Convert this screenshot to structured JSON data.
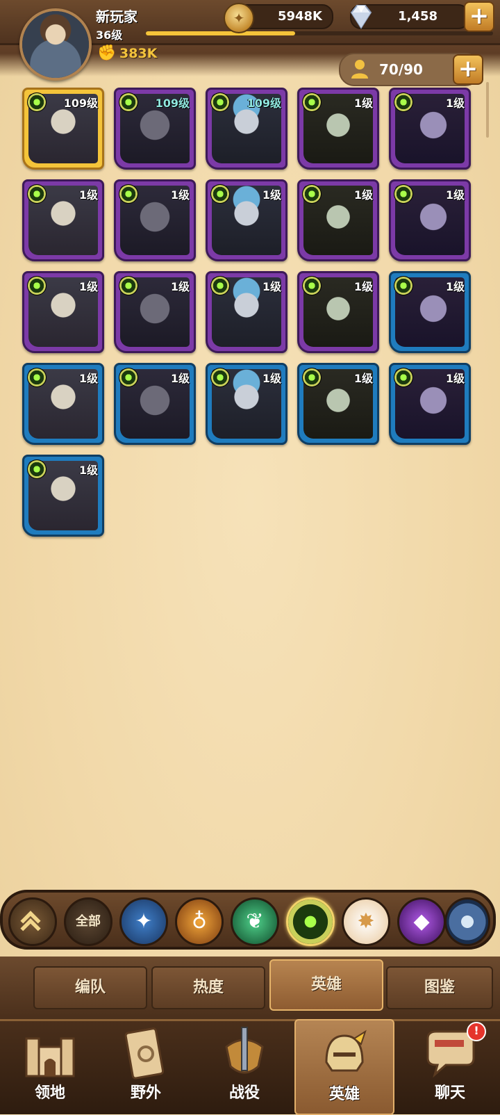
{
  "player": {
    "name": "新玩家",
    "level": "36级",
    "power": "383K",
    "xp_progress": 0.43
  },
  "resources": {
    "gold": "5948K",
    "gems": "1,458",
    "add_label": "+"
  },
  "hero_capacity": "70/90",
  "heroes": [
    {
      "level": "109级",
      "frame": "gold",
      "teal": false
    },
    {
      "level": "109级",
      "frame": "purple",
      "teal": true
    },
    {
      "level": "109级",
      "frame": "purple",
      "teal": true
    },
    {
      "level": "1级",
      "frame": "purple",
      "teal": false
    },
    {
      "level": "1级",
      "frame": "purple",
      "teal": false
    },
    {
      "level": "1级",
      "frame": "purple",
      "teal": false
    },
    {
      "level": "1级",
      "frame": "purple",
      "teal": false
    },
    {
      "level": "1级",
      "frame": "purple",
      "teal": false
    },
    {
      "level": "1级",
      "frame": "purple",
      "teal": false
    },
    {
      "level": "1级",
      "frame": "purple",
      "teal": false
    },
    {
      "level": "1级",
      "frame": "purple",
      "teal": false
    },
    {
      "level": "1级",
      "frame": "purple",
      "teal": false
    },
    {
      "level": "1级",
      "frame": "purple",
      "teal": false
    },
    {
      "level": "1级",
      "frame": "purple",
      "teal": false
    },
    {
      "level": "1级",
      "frame": "blue",
      "teal": false
    },
    {
      "level": "1级",
      "frame": "blue",
      "teal": false
    },
    {
      "level": "1级",
      "frame": "blue",
      "teal": false
    },
    {
      "level": "1级",
      "frame": "blue",
      "teal": false
    },
    {
      "level": "1级",
      "frame": "blue",
      "teal": false
    },
    {
      "level": "1级",
      "frame": "blue",
      "teal": false
    },
    {
      "level": "1级",
      "frame": "blue",
      "teal": false
    }
  ],
  "filters": {
    "all_label": "全部",
    "selected": "graveborn"
  },
  "tabs": [
    "编队",
    "热度",
    "英雄",
    "图鉴"
  ],
  "active_tab": "英雄",
  "nav": [
    {
      "label": "领地",
      "icon": "castle-icon"
    },
    {
      "label": "野外",
      "icon": "scroll-map-icon"
    },
    {
      "label": "战役",
      "icon": "sword-shield-icon"
    },
    {
      "label": "英雄",
      "icon": "helmet-icon",
      "active": true
    },
    {
      "label": "聊天",
      "icon": "chat-icon",
      "badge": "!"
    }
  ],
  "colors": {
    "gold_frame": "#f4c43a",
    "purple_frame": "#7c3aa7",
    "blue_frame": "#1f7cbe",
    "power_text": "#f3c33c"
  }
}
